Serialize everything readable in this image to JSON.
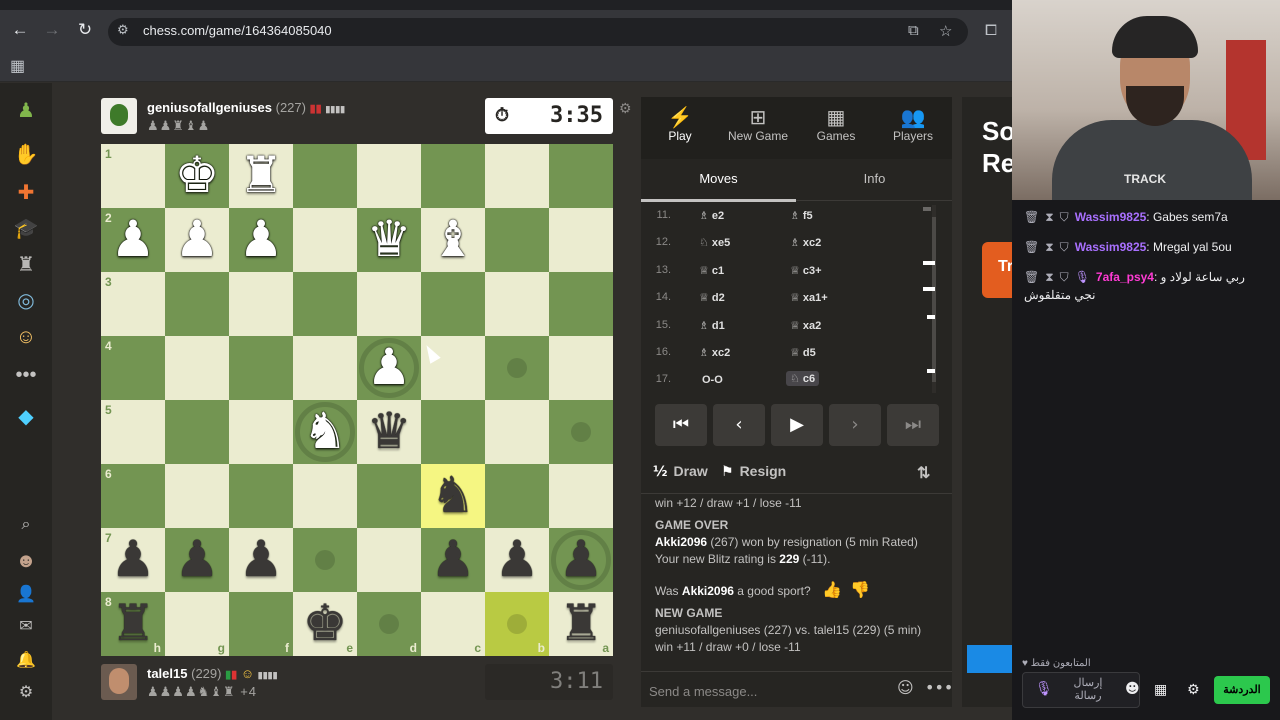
{
  "browser": {
    "url": "chess.com/game/164364085040",
    "icons": {
      "back": "back-arrow-icon",
      "forward": "forward-arrow-icon",
      "reload": "reload-icon",
      "site_info": "tune-icon",
      "install": "install-icon",
      "bookmark": "star-icon",
      "extensions": "extensions-icon",
      "apps": "apps-grid-icon"
    }
  },
  "sidebar": {
    "icons": [
      "pawn-logo-icon",
      "play-icon",
      "puzzles-icon",
      "learn-icon",
      "watch-icon",
      "news-icon",
      "social-icon",
      "more-icon",
      "premium-diamond-icon",
      "search-icon",
      "profile-avatar",
      "friends-icon",
      "messages-icon",
      "notifications-icon",
      "settings-icon"
    ]
  },
  "top_player": {
    "name": "geniusofallgeniuses",
    "rating": "(227)",
    "captured": "♟♟♜♝♟",
    "clock": "3:35",
    "clock_icon": "stopwatch-icon"
  },
  "bottom_player": {
    "name": "talel15",
    "rating": "(229)",
    "captured": "♟♟♟♟♞♝♜",
    "material_diff": "+4",
    "clock": "3:11"
  },
  "board": {
    "ranks": [
      "1",
      "2",
      "3",
      "4",
      "5",
      "6",
      "7",
      "8"
    ],
    "files": [
      "h",
      "g",
      "f",
      "e",
      "d",
      "c",
      "b",
      "a"
    ],
    "colors": {
      "light": "#ebecd0",
      "dark": "#739552",
      "highlight": "#f5f682"
    },
    "pieces": [
      {
        "sq": "g1",
        "type": "king",
        "color": "white",
        "glyph": "♚"
      },
      {
        "sq": "f1",
        "type": "rook",
        "color": "white",
        "glyph": "♜"
      },
      {
        "sq": "h2",
        "type": "pawn",
        "color": "white",
        "glyph": "♟"
      },
      {
        "sq": "g2",
        "type": "pawn",
        "color": "white",
        "glyph": "♟"
      },
      {
        "sq": "f2",
        "type": "pawn",
        "color": "white",
        "glyph": "♟"
      },
      {
        "sq": "d2",
        "type": "queen",
        "color": "white",
        "glyph": "♛"
      },
      {
        "sq": "c2",
        "type": "bishop",
        "color": "white",
        "glyph": "♝"
      },
      {
        "sq": "d4",
        "type": "pawn",
        "color": "white",
        "glyph": "♟"
      },
      {
        "sq": "e5",
        "type": "knight",
        "color": "white",
        "glyph": "♞"
      },
      {
        "sq": "d5",
        "type": "queen",
        "color": "black",
        "glyph": "♛"
      },
      {
        "sq": "c6",
        "type": "knight",
        "color": "black",
        "glyph": "♞"
      },
      {
        "sq": "h7",
        "type": "pawn",
        "color": "black",
        "glyph": "♟"
      },
      {
        "sq": "g7",
        "type": "pawn",
        "color": "black",
        "glyph": "♟"
      },
      {
        "sq": "f7",
        "type": "pawn",
        "color": "black",
        "glyph": "♟"
      },
      {
        "sq": "c7",
        "type": "pawn",
        "color": "black",
        "glyph": "♟"
      },
      {
        "sq": "b7",
        "type": "pawn",
        "color": "black",
        "glyph": "♟"
      },
      {
        "sq": "a7",
        "type": "pawn",
        "color": "black",
        "glyph": "♟"
      },
      {
        "sq": "h8",
        "type": "rook",
        "color": "black",
        "glyph": "♜"
      },
      {
        "sq": "e8",
        "type": "king",
        "color": "black",
        "glyph": "♚"
      },
      {
        "sq": "a8",
        "type": "rook",
        "color": "black",
        "glyph": "♜"
      }
    ],
    "highlighted": [
      "c6",
      "b8"
    ],
    "hint_dots": [
      "b4",
      "a5",
      "e7",
      "d8",
      "b8"
    ],
    "capture_rings": [
      "d4",
      "e5",
      "a7"
    ]
  },
  "panel": {
    "tabs": [
      {
        "label": "Play",
        "icon": "bolt-icon"
      },
      {
        "label": "New Game",
        "icon": "plus-square-icon"
      },
      {
        "label": "Games",
        "icon": "board-icon"
      },
      {
        "label": "Players",
        "icon": "players-icon"
      }
    ],
    "subtabs": [
      "Moves",
      "Info"
    ],
    "moves": [
      {
        "n": "11.",
        "w": "e2",
        "wi": "♗",
        "b": "f5",
        "bi": "♗"
      },
      {
        "n": "12.",
        "w": "xe5",
        "wi": "♘",
        "b": "xc2",
        "bi": "♗"
      },
      {
        "n": "13.",
        "w": "c1",
        "wi": "♕",
        "b": "c3+",
        "bi": "♕"
      },
      {
        "n": "14.",
        "w": "d2",
        "wi": "♕",
        "b": "xa1+",
        "bi": "♕"
      },
      {
        "n": "15.",
        "w": "d1",
        "wi": "♗",
        "b": "xa2",
        "bi": "♕"
      },
      {
        "n": "16.",
        "w": "xc2",
        "wi": "♗",
        "b": "d5",
        "bi": "♕"
      },
      {
        "n": "17.",
        "w": "O-O",
        "wi": "",
        "b": "c6",
        "bi": "♘"
      }
    ],
    "controls": {
      "first": "⏮",
      "prev": "‹",
      "play": "▶",
      "next": "›",
      "last": "⏭"
    },
    "actions": {
      "draw": "Draw",
      "draw_icon": "½",
      "resign": "Resign",
      "flip_icon": "flip-board-icon"
    },
    "feed": {
      "line1": "win +12 / draw +1 / lose -11",
      "game_over_title": "GAME OVER",
      "winner": "Akki2096",
      "winner_rest": "(267) won by resignation (5 min Rated)",
      "rating_prefix": "Your new Blitz rating is",
      "rating_value": "229",
      "rating_suffix": "(-11).",
      "sport_prefix": "Was",
      "sport_name": "Akki2096",
      "sport_suffix": "a good sport?",
      "new_game_title": "NEW GAME",
      "new_game_line": "geniusofallgeniuses (227) vs. talel15 (229) (5 min)",
      "line_last": "win +11 / draw +0 / lose -11"
    },
    "message_placeholder": "Send a message..."
  },
  "promo": {
    "title_line1": "So",
    "title_line2": "Re",
    "button_text": "Tr"
  },
  "webcam": {
    "shirt_text": "TRACK"
  },
  "chat": {
    "messages": [
      {
        "user": "Wassim9825",
        "text": ": Gabes sem7a"
      },
      {
        "user": "Wassim9825",
        "text": ": Mregal yal 5ou"
      },
      {
        "user": "7afa_psy4",
        "text": ": ربي ساعة لولاد و",
        "cont": "نجي متقلقوش"
      }
    ],
    "followers_only": "المتابعون فقط",
    "input_placeholder": "إرسال رسالة",
    "send_button": "الدردشة"
  }
}
